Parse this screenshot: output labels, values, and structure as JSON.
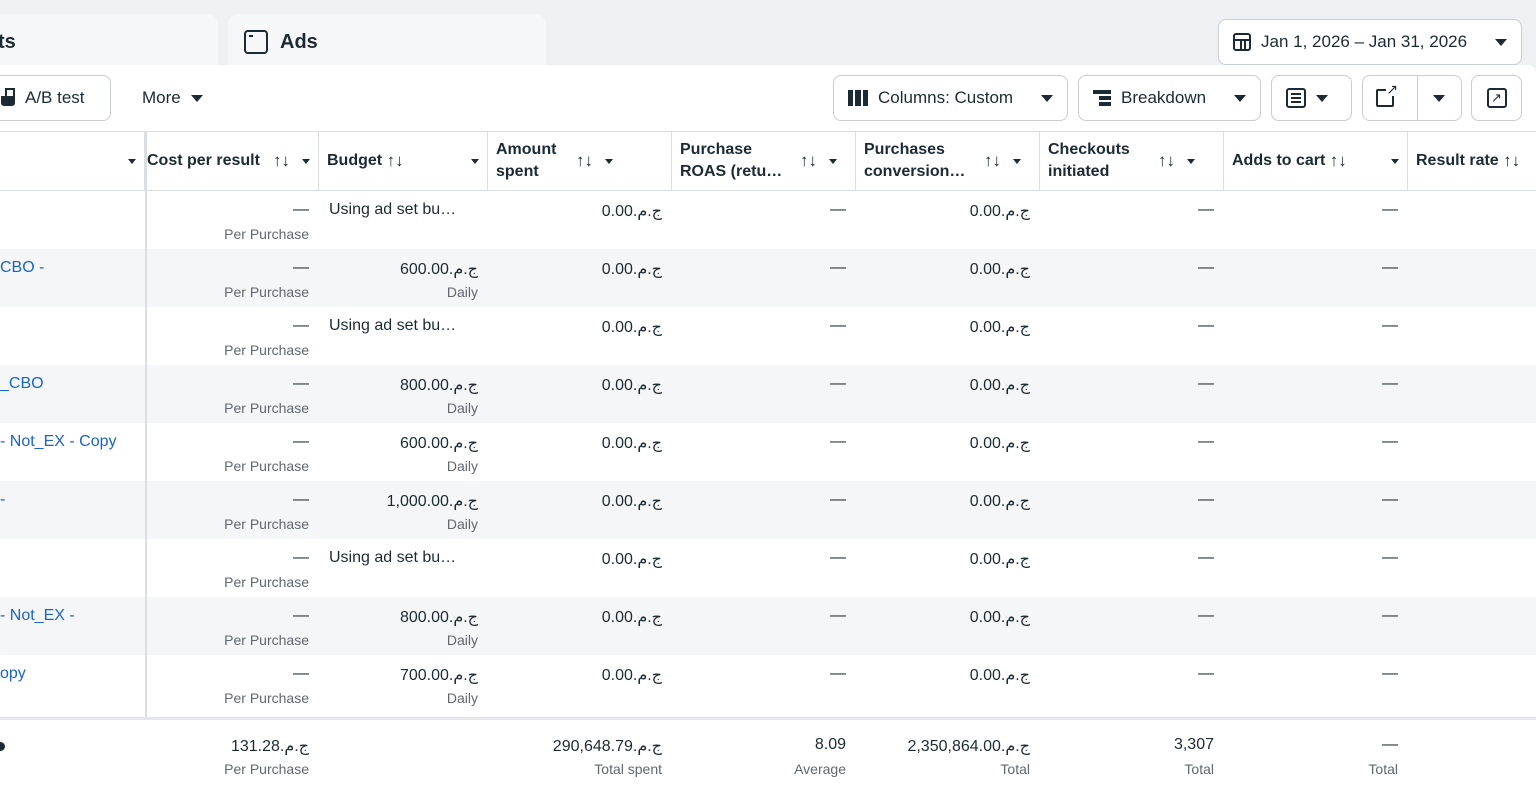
{
  "tabs": [
    {
      "label": "ts"
    },
    {
      "label": "Ads",
      "icon": "ad-window-icon"
    }
  ],
  "date_range": {
    "label": "Jan 1, 2026 – Jan 31, 2026",
    "icon": "calendar-icon"
  },
  "toolbar": {
    "ab_test": "A/B test",
    "more": "More",
    "columns": "Columns: Custom",
    "breakdown": "Breakdown"
  },
  "columns": [
    {
      "label": "",
      "has_sort": false
    },
    {
      "label": "Cost per result"
    },
    {
      "label": "Budget"
    },
    {
      "label": "Amount spent"
    },
    {
      "label": "Purchase ROAS (retu…"
    },
    {
      "label": "Purchases conversion…"
    },
    {
      "label": "Checkouts initiated"
    },
    {
      "label": "Adds to cart"
    },
    {
      "label": "Result rate"
    }
  ],
  "sort_glyph": "↑↓",
  "rows": [
    {
      "name": "",
      "cost": "—",
      "cost_sub": "Per Purchase",
      "budget": "Using ad set bu…",
      "budget_sub": "",
      "spent": "ج.م.0.00",
      "roas": "—",
      "conv": "ج.م.0.00",
      "checkouts": "—",
      "adds": "—"
    },
    {
      "name": "CBO -",
      "cost": "—",
      "cost_sub": "Per Purchase",
      "budget": "ج.م.600.00",
      "budget_sub": "Daily",
      "spent": "ج.م.0.00",
      "roas": "—",
      "conv": "ج.م.0.00",
      "checkouts": "—",
      "adds": "—"
    },
    {
      "name": "",
      "cost": "—",
      "cost_sub": "Per Purchase",
      "budget": "Using ad set bu…",
      "budget_sub": "",
      "spent": "ج.م.0.00",
      "roas": "—",
      "conv": "ج.م.0.00",
      "checkouts": "—",
      "adds": "—"
    },
    {
      "name": "_CBO",
      "cost": "—",
      "cost_sub": "Per Purchase",
      "budget": "ج.م.800.00",
      "budget_sub": "Daily",
      "spent": "ج.م.0.00",
      "roas": "—",
      "conv": "ج.م.0.00",
      "checkouts": "—",
      "adds": "—"
    },
    {
      "name": "- Not_EX - Copy",
      "cost": "—",
      "cost_sub": "Per Purchase",
      "budget": "ج.م.600.00",
      "budget_sub": "Daily",
      "spent": "ج.م.0.00",
      "roas": "—",
      "conv": "ج.م.0.00",
      "checkouts": "—",
      "adds": "—"
    },
    {
      "name": "-",
      "cost": "—",
      "cost_sub": "Per Purchase",
      "budget": "ج.م.1,000.00",
      "budget_sub": "Daily",
      "spent": "ج.م.0.00",
      "roas": "—",
      "conv": "ج.م.0.00",
      "checkouts": "—",
      "adds": "—"
    },
    {
      "name": "",
      "cost": "—",
      "cost_sub": "Per Purchase",
      "budget": "Using ad set bu…",
      "budget_sub": "",
      "spent": "ج.م.0.00",
      "roas": "—",
      "conv": "ج.م.0.00",
      "checkouts": "—",
      "adds": "—"
    },
    {
      "name": "- Not_EX -",
      "cost": "—",
      "cost_sub": "Per Purchase",
      "budget": "ج.م.800.00",
      "budget_sub": "Daily",
      "spent": "ج.م.0.00",
      "roas": "—",
      "conv": "ج.م.0.00",
      "checkouts": "—",
      "adds": "—"
    },
    {
      "name": "opy",
      "cost": "—",
      "cost_sub": "Per Purchase",
      "budget": "ج.م.700.00",
      "budget_sub": "Daily",
      "spent": "ج.م.0.00",
      "roas": "—",
      "conv": "ج.م.0.00",
      "checkouts": "—",
      "adds": "—"
    }
  ],
  "totals": {
    "cost": "ج.م.131.28",
    "cost_sub": "Per Purchase",
    "spent": "ج.م.290,648.79",
    "spent_sub": "Total spent",
    "roas": "8.09",
    "roas_sub": "Average",
    "conv": "ج.م.2,350,864.00",
    "conv_sub": "Total",
    "checkouts": "3,307",
    "checkouts_sub": "Total",
    "adds": "—",
    "adds_sub": "Total"
  },
  "colors": {
    "link": "#1a63c7",
    "border": "#dadde1",
    "alt_row": "#f5f6f7"
  }
}
